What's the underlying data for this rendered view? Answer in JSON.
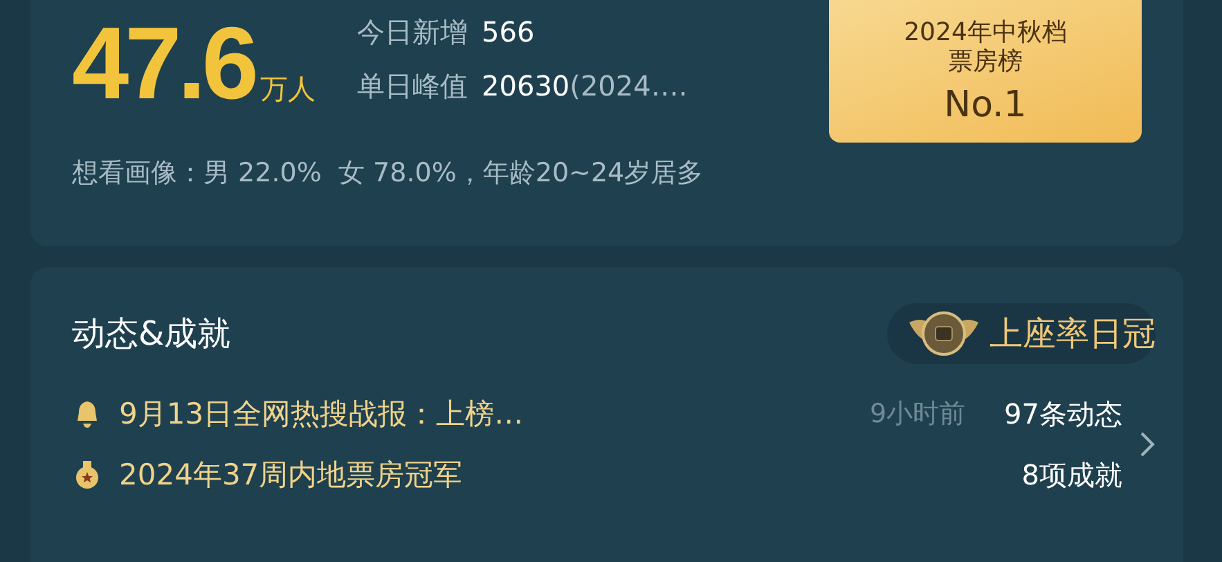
{
  "stats": {
    "big_number": "47.6",
    "unit": "万人",
    "lines": [
      {
        "label": "今日新增",
        "value": "566"
      },
      {
        "label": "单日峰值",
        "value": "20630",
        "suffix": "(2024…."
      }
    ],
    "rank_badge": {
      "title": "2024年中秋档票房榜",
      "rank": "No.1"
    },
    "demographics": "想看画像：男 22.0%  女 78.0%，年龄20~24岁居多"
  },
  "activity": {
    "title": "动态&成就",
    "honor": "上座率日冠",
    "items": [
      {
        "kind": "bell",
        "text": "9月13日全网热搜战报：上榜…",
        "time": "9小时前",
        "count": "97条动态"
      },
      {
        "kind": "medal",
        "text": "2024年37周内地票房冠军",
        "count": "8项成就"
      }
    ]
  }
}
